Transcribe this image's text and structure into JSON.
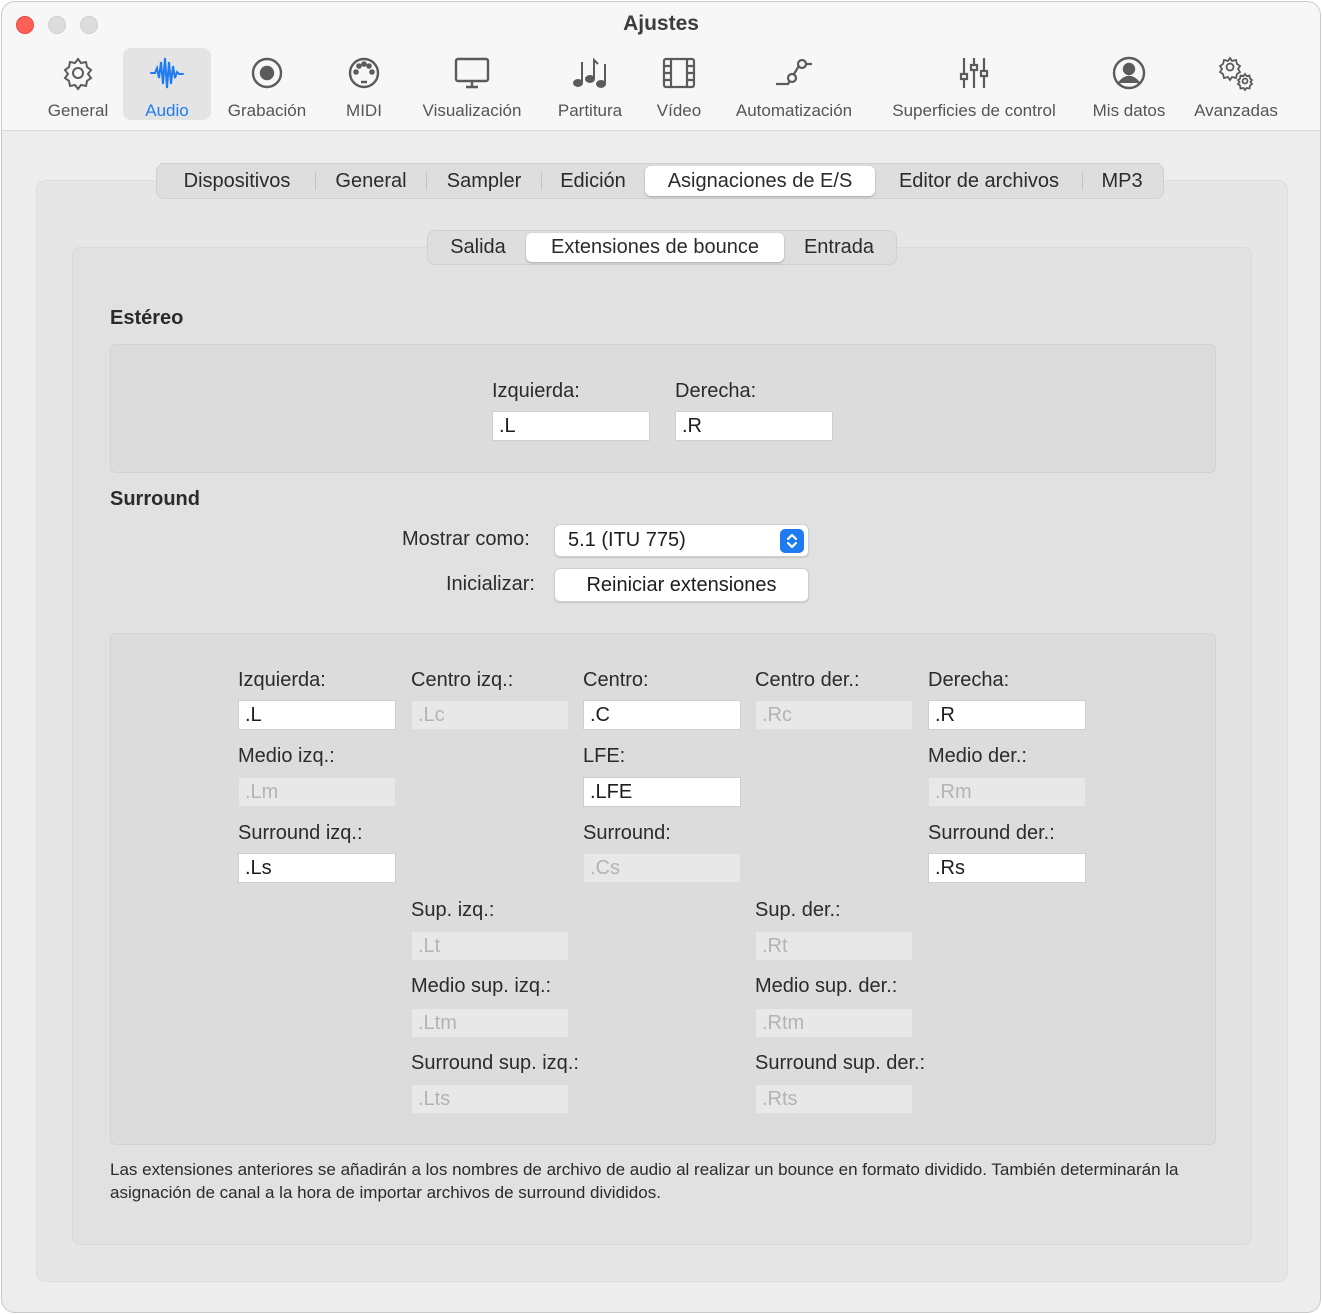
{
  "window": {
    "title": "Ajustes"
  },
  "toolbar": [
    {
      "label": "General",
      "icon": "gear-icon"
    },
    {
      "label": "Audio",
      "icon": "waveform-icon"
    },
    {
      "label": "Grabación",
      "icon": "record-icon"
    },
    {
      "label": "MIDI",
      "icon": "midi-icon"
    },
    {
      "label": "Visualización",
      "icon": "display-icon"
    },
    {
      "label": "Partitura",
      "icon": "notes-icon"
    },
    {
      "label": "Vídeo",
      "icon": "film-icon"
    },
    {
      "label": "Automatización",
      "icon": "automation-icon"
    },
    {
      "label": "Superficies de control",
      "icon": "sliders-icon"
    },
    {
      "label": "Mis datos",
      "icon": "person-icon"
    },
    {
      "label": "Avanzadas",
      "icon": "gears-icon"
    }
  ],
  "toolbar_active": "Audio",
  "accent_color": "#1f7bf2",
  "tabs": [
    "Dispositivos",
    "General",
    "Sampler",
    "Edición",
    "Asignaciones de E/S",
    "Editor de archivos",
    "MP3"
  ],
  "tabs_active": "Asignaciones de E/S",
  "subtabs": [
    "Salida",
    "Extensiones de bounce",
    "Entrada"
  ],
  "subtabs_active": "Extensiones de bounce",
  "stereo": {
    "title": "Estéreo",
    "left_label": "Izquierda:",
    "left_value": ".L",
    "right_label": "Derecha:",
    "right_value": ".R"
  },
  "surround": {
    "title": "Surround",
    "show_as_label": "Mostrar como:",
    "show_as_value": "5.1 (ITU 775)",
    "init_label": "Inicializar:",
    "reset_button": "Reiniciar extensiones",
    "fields": {
      "izquierda": {
        "label": "Izquierda:",
        "value": ".L",
        "enabled": true
      },
      "centro_izq": {
        "label": "Centro izq.:",
        "value": ".Lc",
        "enabled": false
      },
      "centro": {
        "label": "Centro:",
        "value": ".C",
        "enabled": true
      },
      "centro_der": {
        "label": "Centro der.:",
        "value": ".Rc",
        "enabled": false
      },
      "derecha": {
        "label": "Derecha:",
        "value": ".R",
        "enabled": true
      },
      "medio_izq": {
        "label": "Medio izq.:",
        "value": ".Lm",
        "enabled": false
      },
      "lfe": {
        "label": "LFE:",
        "value": ".LFE",
        "enabled": true
      },
      "medio_der": {
        "label": "Medio der.:",
        "value": ".Rm",
        "enabled": false
      },
      "surround_izq": {
        "label": "Surround izq.:",
        "value": ".Ls",
        "enabled": true
      },
      "surround": {
        "label": "Surround:",
        "value": ".Cs",
        "enabled": false
      },
      "surround_der": {
        "label": "Surround der.:",
        "value": ".Rs",
        "enabled": true
      },
      "sup_izq": {
        "label": "Sup. izq.:",
        "value": ".Lt",
        "enabled": false
      },
      "sup_der": {
        "label": "Sup. der.:",
        "value": ".Rt",
        "enabled": false
      },
      "medio_sup_izq": {
        "label": "Medio sup. izq.:",
        "value": ".Ltm",
        "enabled": false
      },
      "medio_sup_der": {
        "label": "Medio sup. der.:",
        "value": ".Rtm",
        "enabled": false
      },
      "surround_sup_izq": {
        "label": "Surround sup. izq.:",
        "value": ".Lts",
        "enabled": false
      },
      "surround_sup_der": {
        "label": "Surround sup. der.:",
        "value": ".Rts",
        "enabled": false
      }
    }
  },
  "footer": "Las extensiones anteriores se añadirán a los nombres de archivo de audio al realizar un bounce en formato dividido. También determinarán la asignación de canal a la hora de importar archivos de surround divididos."
}
